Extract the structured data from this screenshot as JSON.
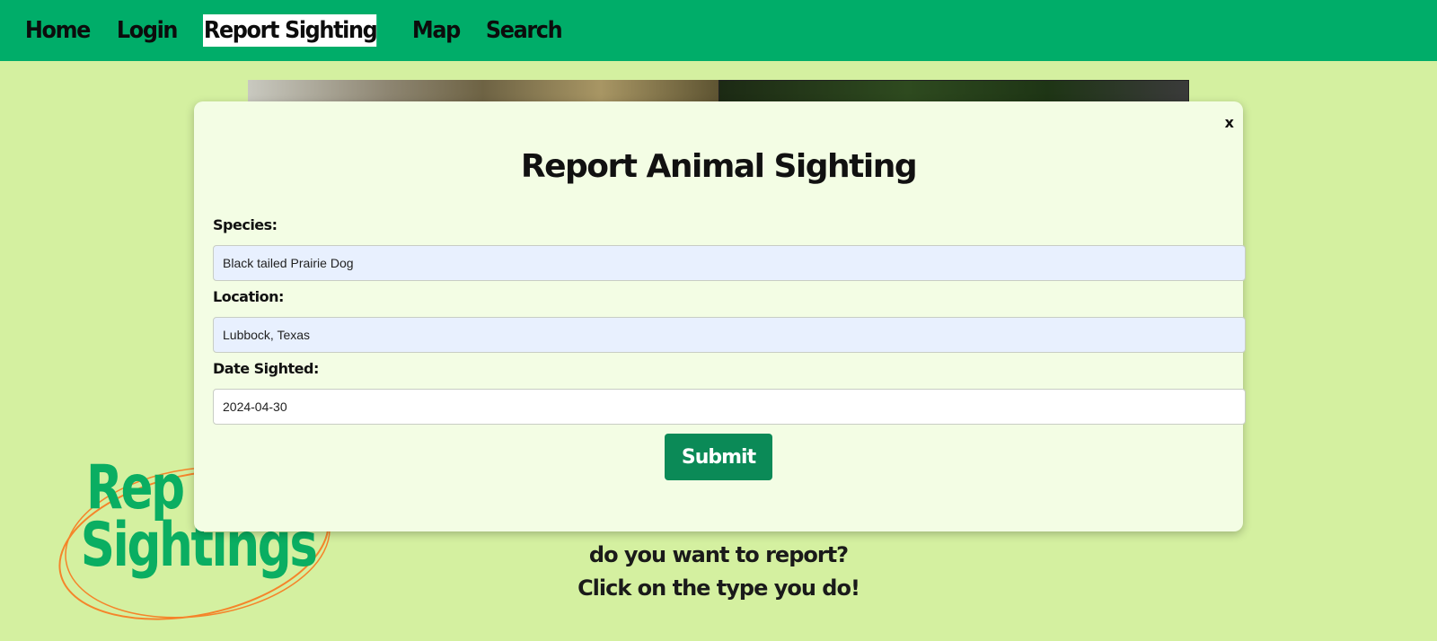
{
  "nav": {
    "items": [
      {
        "label": "Home",
        "active": false
      },
      {
        "label": "Login",
        "active": false
      },
      {
        "label": "Report Sighting",
        "active": true
      },
      {
        "label": "Map",
        "active": false
      },
      {
        "label": "Search",
        "active": false
      }
    ]
  },
  "colors": {
    "nav_bg": "#00ad69",
    "page_bg": "#d4f0a0",
    "modal_bg": "#f3fde4",
    "submit_bg": "#0b8a57",
    "logo_green": "#0aae62",
    "logo_ring": "#f5842a"
  },
  "modal": {
    "close_label": "x",
    "title": "Report Animal Sighting",
    "fields": {
      "species": {
        "label": "Species:",
        "value": "Black tailed Prairie Dog"
      },
      "location": {
        "label": "Location:",
        "value": "Lubbock, Texas"
      },
      "date": {
        "label": "Date Sighted:",
        "value": "2024-04-30"
      }
    },
    "submit_label": "Submit"
  },
  "logo": {
    "line1": "Rep",
    "line2": "Sightings"
  },
  "page_text": {
    "line1": "do you want to report?",
    "line2": "Click on the type you do!"
  }
}
